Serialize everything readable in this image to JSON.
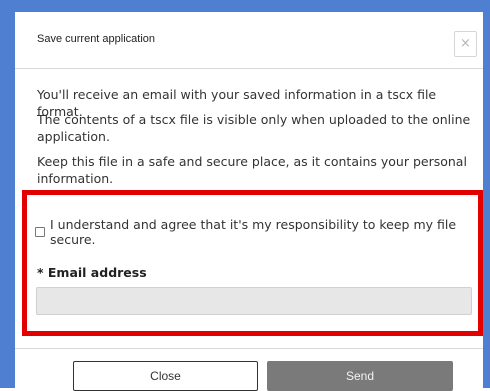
{
  "dialog": {
    "title": "Save current application",
    "close_icon": "×",
    "paragraphs": [
      "You'll receive an email with your saved information in a tscx file format.",
      "The contents of a tscx file is visible only when uploaded to the online application.",
      "Keep this file in a safe and secure place, as it contains your personal information."
    ],
    "agreement_label": "I understand and agree that it's my responsibility to keep my file secure.",
    "agreement_checked": false,
    "email": {
      "label": "* Email address",
      "value": "",
      "placeholder": ""
    },
    "buttons": {
      "close": "Close",
      "send": "Send"
    }
  },
  "colors": {
    "frame_border": "#4f7fd1",
    "highlight": "#e30000",
    "send_button": "#7a7a7a",
    "input_bg": "#e7e7e7"
  }
}
